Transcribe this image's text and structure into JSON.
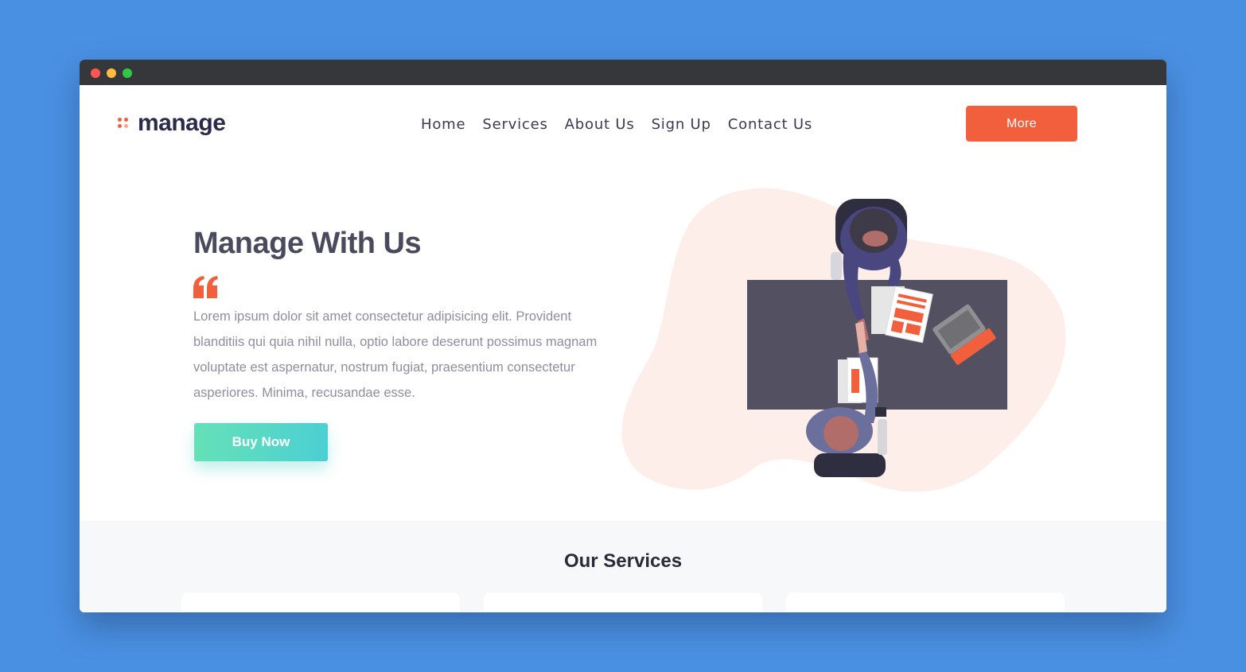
{
  "brand": {
    "logo_text": "manage",
    "accent_color": "#f15f3c",
    "teal_gradient": [
      "#65e1b7",
      "#4ccfd3"
    ],
    "desktop_background": "#4a90e2"
  },
  "nav": {
    "items": [
      "Home",
      "Services",
      "About Us",
      "Sign Up",
      "Contact Us"
    ],
    "more_label": "More"
  },
  "hero": {
    "title": "Manage With Us",
    "quote_icon": "quote-icon",
    "text": "Lorem ipsum dolor sit amet consectetur adipisicing elit. Provident blanditiis qui quia nihil nulla, optio labore deserunt possimus magnam voluptate est aspernatur, nostrum fugiat, praesentium consectetur asperiores. Minima, recusandae esse.",
    "cta_label": "Buy Now",
    "illustration": "handshake-illustration"
  },
  "services": {
    "title": "Our Services"
  }
}
